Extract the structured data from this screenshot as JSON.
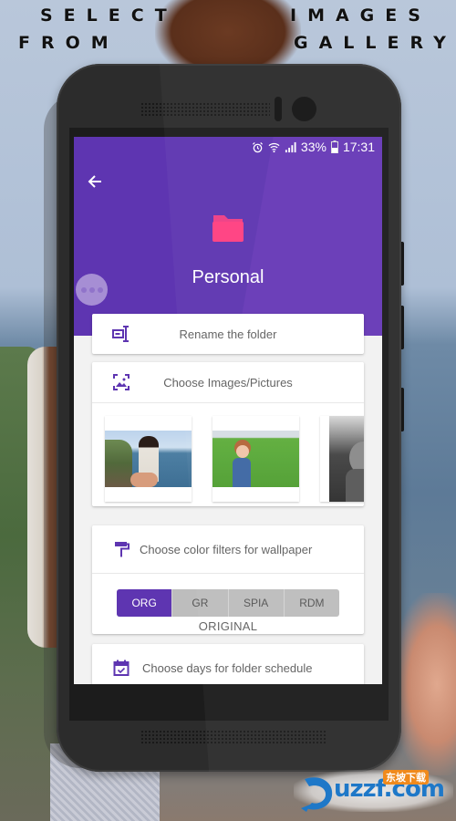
{
  "promo": {
    "headline_line1_left": "SELECT",
    "headline_line1_right": "IMAGES",
    "headline_line2_left": "FROM",
    "headline_line2_right": "GALLERY"
  },
  "status_bar": {
    "icons": [
      "alarm-icon",
      "wifi-icon",
      "signal-icon",
      "battery-icon"
    ],
    "battery": "33%",
    "time": "17:31"
  },
  "app_bar": {
    "back_icon": "arrow-left-icon",
    "folder_icon": "folder-icon",
    "folder_title": "Personal"
  },
  "colors": {
    "primary": "#5e35b1",
    "primary_light": "#673ab7",
    "folder": "#ff4081",
    "fab": "#b39ddb"
  },
  "cards": {
    "rename": {
      "icon": "rename-icon",
      "label": "Rename the folder"
    },
    "images": {
      "icon": "image-select-icon",
      "label": "Choose Images/Pictures",
      "thumbnails": [
        {
          "name": "cliff-sea-holding-hand"
        },
        {
          "name": "child-in-grass"
        },
        {
          "name": "black-white-portrait"
        }
      ]
    },
    "filters": {
      "icon": "paint-roller-icon",
      "label": "Choose color filters for wallpaper",
      "options": [
        "ORG",
        "GR",
        "SPIA",
        "RDM"
      ],
      "selected": "ORG",
      "selected_caption": "ORIGINAL"
    },
    "schedule": {
      "icon": "calendar-check-icon",
      "label": "Choose days for folder schedule"
    }
  },
  "fab": {
    "icon": "more-horizontal-icon"
  },
  "watermark": {
    "brand": "uzzf.com",
    "brand_cn": "东坡下载"
  }
}
